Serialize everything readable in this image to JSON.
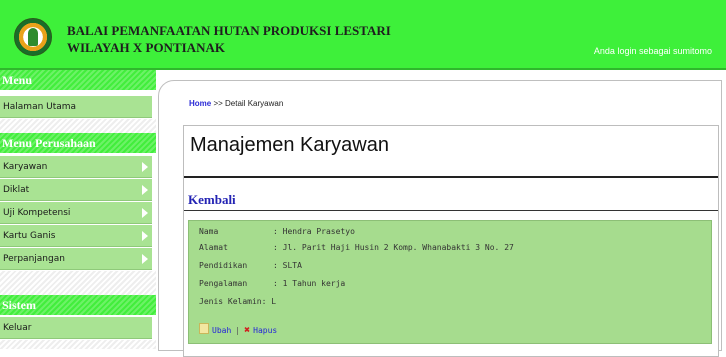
{
  "header": {
    "org_line1": "BALAI PEMANFAATAN HUTAN PRODUKSI LESTARI",
    "org_line2": "WILAYAH X PONTIANAK",
    "login_text": "Anda login sebagai sumitomo"
  },
  "sidebar": {
    "sections": [
      {
        "title": "Menu",
        "items": [
          {
            "label": "Halaman Utama"
          }
        ]
      },
      {
        "title": "Menu Perusahaan",
        "items": [
          {
            "label": "Karyawan"
          },
          {
            "label": "Diklat"
          },
          {
            "label": "Uji Kompetensi"
          },
          {
            "label": "Kartu Ganis"
          },
          {
            "label": "Perpanjangan"
          }
        ]
      },
      {
        "title": "Sistem",
        "items": [
          {
            "label": "Keluar"
          }
        ]
      }
    ]
  },
  "breadcrumb": {
    "home": "Home",
    "sep": " >> ",
    "current": "Detail Karyawan"
  },
  "page_title": "Manajemen Karyawan",
  "back_link": "Kembali",
  "detail": [
    {
      "label": "Nama",
      "value": ": Hendra Prasetyo"
    },
    {
      "label": "Alamat",
      "value": ": Jl. Parit Haji Husin 2 Komp. Whanabakti 3 No. 27"
    },
    {
      "label": "Pendidikan",
      "value": ": SLTA"
    },
    {
      "label": "Pengalaman",
      "value": ": 1 Tahun kerja"
    },
    {
      "label": "Jenis Kelamin",
      "value": ": L"
    }
  ],
  "actions": {
    "edit": "Ubah",
    "sep": "|",
    "delete": "Hapus"
  }
}
